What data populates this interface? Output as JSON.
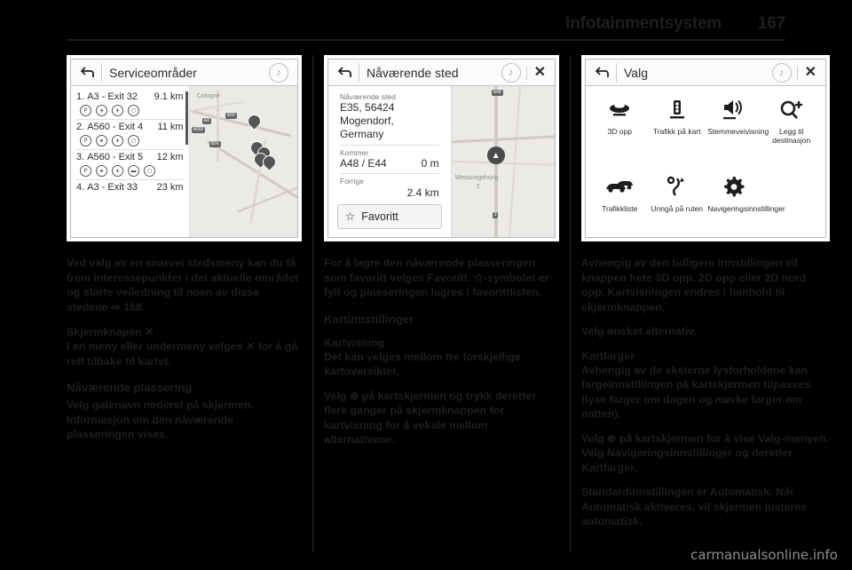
{
  "header": {
    "title": "Infotainmentsystem",
    "page_number": "167"
  },
  "screens": [
    {
      "title": "Serviceområder",
      "back_icon": "back-arrow-icon",
      "note_icon": "music-note-icon",
      "has_close": false,
      "list": [
        {
          "index": "1.",
          "name": "A3 - Exit 32",
          "distance": "9.1 km",
          "icons": [
            "P",
            "C",
            "R",
            "U"
          ]
        },
        {
          "index": "2.",
          "name": "A560 - Exit 4",
          "distance": "11 km",
          "icons": [
            "P",
            "C",
            "R",
            "U"
          ]
        },
        {
          "index": "3.",
          "name": "A560 - Exit 5",
          "distance": "12 km",
          "icons": [
            "P",
            "C",
            "R",
            "H",
            "U"
          ]
        },
        {
          "index": "4.",
          "name": "A3 - Exit 33",
          "distance": "23 km",
          "icons": []
        }
      ],
      "map_labels": [
        "Cologne"
      ],
      "map_shields": [
        "A3",
        "A59",
        "A560",
        "B56"
      ]
    },
    {
      "title": "Nåværende sted",
      "back_icon": "back-arrow-icon",
      "note_icon": "music-note-icon",
      "has_close": true,
      "close_icon": "close-icon",
      "fields": [
        {
          "label": "Nåværende sted",
          "value": "E35, 56424 Mogendorf, Germany",
          "distance": ""
        },
        {
          "label": "Kommer",
          "value": "A48 / E44",
          "distance": "0 m"
        },
        {
          "label": "Forrige",
          "value": "",
          "distance": "2.4 km"
        }
      ],
      "favourite_button": {
        "label": "Favoritt",
        "icon": "star-outline-icon"
      },
      "map_labels": [
        "Westumgehung",
        "2"
      ],
      "map_shields": [
        "A48",
        "3"
      ]
    },
    {
      "title": "Valg",
      "back_icon": "back-arrow-icon",
      "note_icon": "music-note-icon",
      "has_close": true,
      "close_icon": "close-icon",
      "options": [
        {
          "label": "3D opp",
          "icon": "3d-map-icon"
        },
        {
          "label": "Trafikk på kart",
          "icon": "traffic-light-icon"
        },
        {
          "label": "Stemmeveivisning",
          "icon": "speaker-icon"
        },
        {
          "label": "Legg til destinasjon",
          "icon": "magnifier-plus-icon"
        },
        {
          "label": "Trafikkliste",
          "icon": "traffic-jam-icon"
        },
        {
          "label": "Unngå på ruten",
          "icon": "route-detour-icon"
        },
        {
          "label": "Navigeringsinnstillinger",
          "icon": "gear-icon"
        }
      ]
    }
  ],
  "columns": {
    "left": [
      {
        "type": "para",
        "text": "Ved valg av en snarvei stedsmeny kan du få frem interessepunkter i det aktuelle området og starte veiledning til noen av disse stedene ⇨ 168."
      },
      {
        "type": "h3",
        "text": "Skjermknapen ✕"
      },
      {
        "type": "para",
        "text": "I en meny eller undermeny velges ✕ for å gå rett tilbake til kartet."
      },
      {
        "type": "h2",
        "text": "Nåværende plassering"
      },
      {
        "type": "para",
        "text": "Velg gatenavn nederst på skjermen. Informasjon om den nåværende plasseringen vises."
      }
    ],
    "middle": [
      {
        "type": "para",
        "text": "For å lagre den nåværende plasseringen som favoritt velges Favoritt. ☆-symbolet er fylt og plasseringen lagres i favorittlisten."
      },
      {
        "type": "h2",
        "text": "Kartinnstillinger"
      },
      {
        "type": "h3",
        "text": "Kartvisning"
      },
      {
        "type": "para",
        "text": "Det kan velges mellom tre forskjellige kartoversikter."
      },
      {
        "type": "para",
        "text": "Velg ⊕ på kartskjermen og trykk deretter flere ganger på skjermknappen for kartvisning for å veksle mellom alternativene."
      }
    ],
    "right": [
      {
        "type": "para",
        "text": "Avhengig av den tidligere innstillingen vil knappen hete 3D opp, 2D opp eller 2D nord opp. Kartvisningen endres i henhold til skjermknappen."
      },
      {
        "type": "para",
        "text": "Velg ønsket alternativ."
      },
      {
        "type": "h3",
        "text": "Kartfarger"
      },
      {
        "type": "para",
        "text": "Avhengig av de eksterne lysforholdene kan fargeinnstillingen på kartskjermen tilpasses (lyse farger om dagen og mørke farger om natten)."
      },
      {
        "type": "para",
        "text": "Velg ⊕ på kartskjermen for å vise Valg-menyen. Velg Navigeringsinnstillinger og deretter Kartfarger."
      },
      {
        "type": "para",
        "text": "Standardinnstillingen er Automatisk. Når Automatisk aktiveres, vil skjermen justeres automatisk."
      }
    ]
  },
  "watermark": "carmanualsonline.info"
}
